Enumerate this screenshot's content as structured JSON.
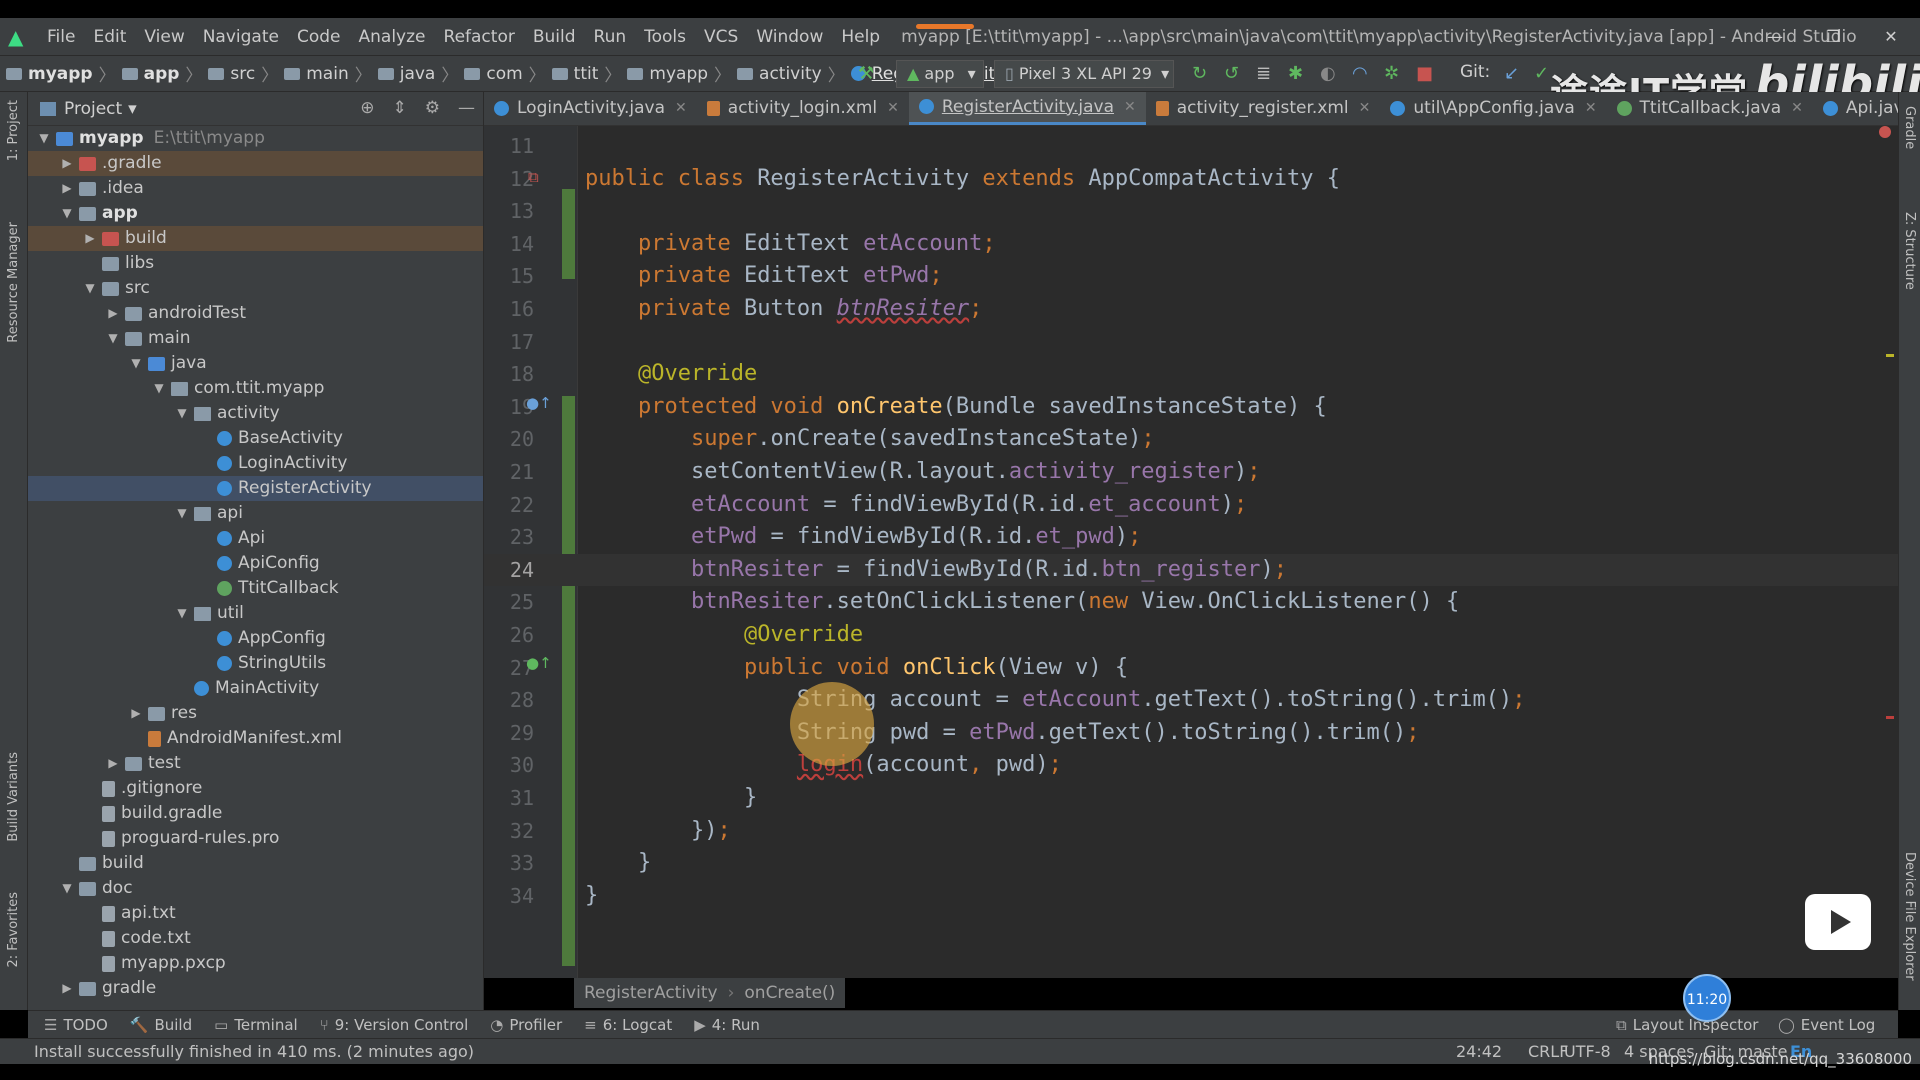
{
  "window": {
    "menu": [
      "File",
      "Edit",
      "View",
      "Navigate",
      "Code",
      "Analyze",
      "Refactor",
      "Build",
      "Run",
      "Tools",
      "VCS",
      "Window",
      "Help"
    ],
    "title": "myapp [E:\\ttit\\myapp] - ...\\app\\src\\main\\java\\com\\ttit\\myapp\\activity\\RegisterActivity.java [app] - Android Studio",
    "controls": [
      "—",
      "❐",
      "✕"
    ]
  },
  "navbar": {
    "crumbs": [
      "myapp",
      "app",
      "src",
      "main",
      "java",
      "com",
      "ttit",
      "myapp",
      "activity",
      "RegisterActivity"
    ],
    "run_config": "app",
    "device": "Pixel 3 XL API 29",
    "git_label": "Git:"
  },
  "watermark": {
    "text": "途途IT学堂",
    "bilibili": "bilibili"
  },
  "left_strip": {
    "project_label": "1: Project",
    "resource_manager": "Resource Manager",
    "build_variants": "Build Variants",
    "favorites": "2: Favorites"
  },
  "right_strip": {
    "gradle": "Gradle",
    "structure": "Z: Structure",
    "device_file_explorer": "Device File Explorer"
  },
  "project_panel": {
    "header": "Project",
    "tree": [
      {
        "label": "myapp",
        "extra": "E:\\ttit\\myapp",
        "depth": 0,
        "arrow": "▼",
        "icon": "bluefolder",
        "bold": true
      },
      {
        "label": ".gradle",
        "depth": 1,
        "arrow": "▶",
        "icon": "redfolder",
        "hl": "brown"
      },
      {
        "label": ".idea",
        "depth": 1,
        "arrow": "▶",
        "icon": "folder"
      },
      {
        "label": "app",
        "depth": 1,
        "arrow": "▼",
        "icon": "folder",
        "bold": true
      },
      {
        "label": "build",
        "depth": 2,
        "arrow": "▶",
        "icon": "redfolder",
        "hl": "brown"
      },
      {
        "label": "libs",
        "depth": 2,
        "arrow": "",
        "icon": "folder"
      },
      {
        "label": "src",
        "depth": 2,
        "arrow": "▼",
        "icon": "folder"
      },
      {
        "label": "androidTest",
        "depth": 3,
        "arrow": "▶",
        "icon": "folder"
      },
      {
        "label": "main",
        "depth": 3,
        "arrow": "▼",
        "icon": "folder"
      },
      {
        "label": "java",
        "depth": 4,
        "arrow": "▼",
        "icon": "bluefolder"
      },
      {
        "label": "com.ttit.myapp",
        "depth": 5,
        "arrow": "▼",
        "icon": "pkg"
      },
      {
        "label": "activity",
        "depth": 6,
        "arrow": "▼",
        "icon": "pkg"
      },
      {
        "label": "BaseActivity",
        "depth": 7,
        "arrow": "",
        "icon": "cls"
      },
      {
        "label": "LoginActivity",
        "depth": 7,
        "arrow": "",
        "icon": "cls"
      },
      {
        "label": "RegisterActivity",
        "depth": 7,
        "arrow": "",
        "icon": "cls",
        "selected": true
      },
      {
        "label": "api",
        "depth": 6,
        "arrow": "▼",
        "icon": "pkg"
      },
      {
        "label": "Api",
        "depth": 7,
        "arrow": "",
        "icon": "cls"
      },
      {
        "label": "ApiConfig",
        "depth": 7,
        "arrow": "",
        "icon": "cls"
      },
      {
        "label": "TtitCallback",
        "depth": 7,
        "arrow": "",
        "icon": "intf"
      },
      {
        "label": "util",
        "depth": 6,
        "arrow": "▼",
        "icon": "pkg"
      },
      {
        "label": "AppConfig",
        "depth": 7,
        "arrow": "",
        "icon": "cls"
      },
      {
        "label": "StringUtils",
        "depth": 7,
        "arrow": "",
        "icon": "cls"
      },
      {
        "label": "MainActivity",
        "depth": 6,
        "arrow": "",
        "icon": "cls"
      },
      {
        "label": "res",
        "depth": 4,
        "arrow": "▶",
        "icon": "folder"
      },
      {
        "label": "AndroidManifest.xml",
        "depth": 4,
        "arrow": "",
        "icon": "xml"
      },
      {
        "label": "test",
        "depth": 3,
        "arrow": "▶",
        "icon": "folder"
      },
      {
        "label": ".gitignore",
        "depth": 2,
        "arrow": "",
        "icon": "file"
      },
      {
        "label": "build.gradle",
        "depth": 2,
        "arrow": "",
        "icon": "file"
      },
      {
        "label": "proguard-rules.pro",
        "depth": 2,
        "arrow": "",
        "icon": "file"
      },
      {
        "label": "build",
        "depth": 1,
        "arrow": "",
        "icon": "folder"
      },
      {
        "label": "doc",
        "depth": 1,
        "arrow": "▼",
        "icon": "folder"
      },
      {
        "label": "api.txt",
        "depth": 2,
        "arrow": "",
        "icon": "file"
      },
      {
        "label": "code.txt",
        "depth": 2,
        "arrow": "",
        "icon": "file"
      },
      {
        "label": "myapp.pxcp",
        "depth": 2,
        "arrow": "",
        "icon": "file"
      },
      {
        "label": "gradle",
        "depth": 1,
        "arrow": "▶",
        "icon": "folder"
      }
    ]
  },
  "tabs": [
    {
      "label": "LoginActivity.java",
      "icon": "c"
    },
    {
      "label": "activity_login.xml",
      "icon": "x"
    },
    {
      "label": "RegisterActivity.java",
      "icon": "c",
      "active": true
    },
    {
      "label": "activity_register.xml",
      "icon": "x"
    },
    {
      "label": "util\\AppConfig.java",
      "icon": "c"
    },
    {
      "label": "TtitCallback.java",
      "icon": "i"
    },
    {
      "label": "Api.java",
      "icon": "c"
    }
  ],
  "editor": {
    "current_line": 24,
    "lines": [
      {
        "n": "11",
        "html": ""
      },
      {
        "n": "12",
        "html": "<span class=\"ksw\">public class </span>RegisterActivity <span class=\"ksw\">extends </span>AppCompatActivity {"
      },
      {
        "n": "13",
        "html": ""
      },
      {
        "n": "14",
        "html": "    <span class=\"ksw\">private </span>EditText <span class=\"fld\">etAccount</span><span class=\"punc\">;</span>"
      },
      {
        "n": "15",
        "html": "    <span class=\"ksw\">private </span>EditText <span class=\"fld\">etPwd</span><span class=\"punc\">;</span>"
      },
      {
        "n": "16",
        "html": "    <span class=\"ksw\">private </span>Button <span class=\"warn\">btnResiter</span><span class=\"punc\">;</span>"
      },
      {
        "n": "17",
        "html": ""
      },
      {
        "n": "18",
        "html": "    <span class=\"ann\">@Override</span>"
      },
      {
        "n": "19",
        "html": "    <span class=\"ksw\">protected void </span><span class=\"mth\">onCreate</span>(Bundle savedInstanceState) {"
      },
      {
        "n": "20",
        "html": "        <span class=\"ksw\">super</span>.onCreate(savedInstanceState)<span class=\"punc\">;</span>"
      },
      {
        "n": "21",
        "html": "        setContentView(R.layout.<span class=\"fld\">activity_register</span>)<span class=\"punc\">;</span>"
      },
      {
        "n": "22",
        "html": "        <span class=\"fld\">etAccount </span>= findViewById(R.id.<span class=\"fld\">et_account</span>)<span class=\"punc\">;</span>"
      },
      {
        "n": "23",
        "html": "        <span class=\"fld\">etPwd </span>= findViewById(R.id.<span class=\"fld\">et_pwd</span>)<span class=\"punc\">;</span>"
      },
      {
        "n": "24",
        "html": "        <span class=\"fld\">btnResiter </span>= findViewById(R.id.<span class=\"fld\">btn_register</span>)<span class=\"punc\">;</span>"
      },
      {
        "n": "25",
        "html": "        <span class=\"fld\">btnResiter</span>.setOnClickListener(<span class=\"ksw\">new </span>View.OnClickListener() {"
      },
      {
        "n": "26",
        "html": "            <span class=\"ann\">@Override</span>"
      },
      {
        "n": "27",
        "html": "            <span class=\"ksw\">public void </span><span class=\"mth\">onClick</span>(View v) {"
      },
      {
        "n": "28",
        "html": "                String account = <span class=\"fld\">etAccount</span>.getText().toString().trim()<span class=\"punc\">;</span>"
      },
      {
        "n": "29",
        "html": "                String pwd = <span class=\"fld\">etPwd</span>.getText().toString().trim()<span class=\"punc\">;</span>"
      },
      {
        "n": "30",
        "html": "                <span class=\"err\">login</span>(account<span class=\"punc\">, </span>pwd)<span class=\"punc\">;</span>"
      },
      {
        "n": "31",
        "html": "            }"
      },
      {
        "n": "32",
        "html": "        })<span class=\"punc\">;</span>"
      },
      {
        "n": "33",
        "html": "    }"
      },
      {
        "n": "34",
        "html": "}"
      }
    ]
  },
  "editor_breadcrumb": [
    "RegisterActivity",
    "onCreate()"
  ],
  "bottom_tools": [
    {
      "icon": "☰",
      "label": "TODO"
    },
    {
      "icon": "🔨",
      "label": "Build"
    },
    {
      "icon": "▭",
      "label": "Terminal"
    },
    {
      "icon": "⑂",
      "label": "9: Version Control"
    },
    {
      "icon": "◔",
      "label": "Profiler"
    },
    {
      "icon": "≡",
      "label": "6: Logcat"
    },
    {
      "icon": "▶",
      "label": "4: Run"
    }
  ],
  "bottom_right_tools": [
    {
      "icon": "⧉",
      "label": "Layout Inspector"
    },
    {
      "icon": "◯",
      "label": "Event Log"
    }
  ],
  "status": {
    "message": "Install successfully finished in 410 ms. (2 minutes ago)",
    "position": "24:42",
    "line_sep": "CRLF",
    "encoding": "UTF-8",
    "indent": "4 spaces",
    "git": "Git: maste",
    "ime": "En"
  },
  "overlay": {
    "time": "11:20",
    "csdn": "https://blog.csdn.net/qq_33608000"
  },
  "colors": {
    "accent": "#4a88c7",
    "editor_bg": "#2b2b2b",
    "panel_bg": "#3c3f41",
    "keyword": "#cc7832",
    "field": "#9876aa",
    "method": "#ffc66d",
    "annotation": "#bbb529",
    "error": "#bc3f3c"
  }
}
